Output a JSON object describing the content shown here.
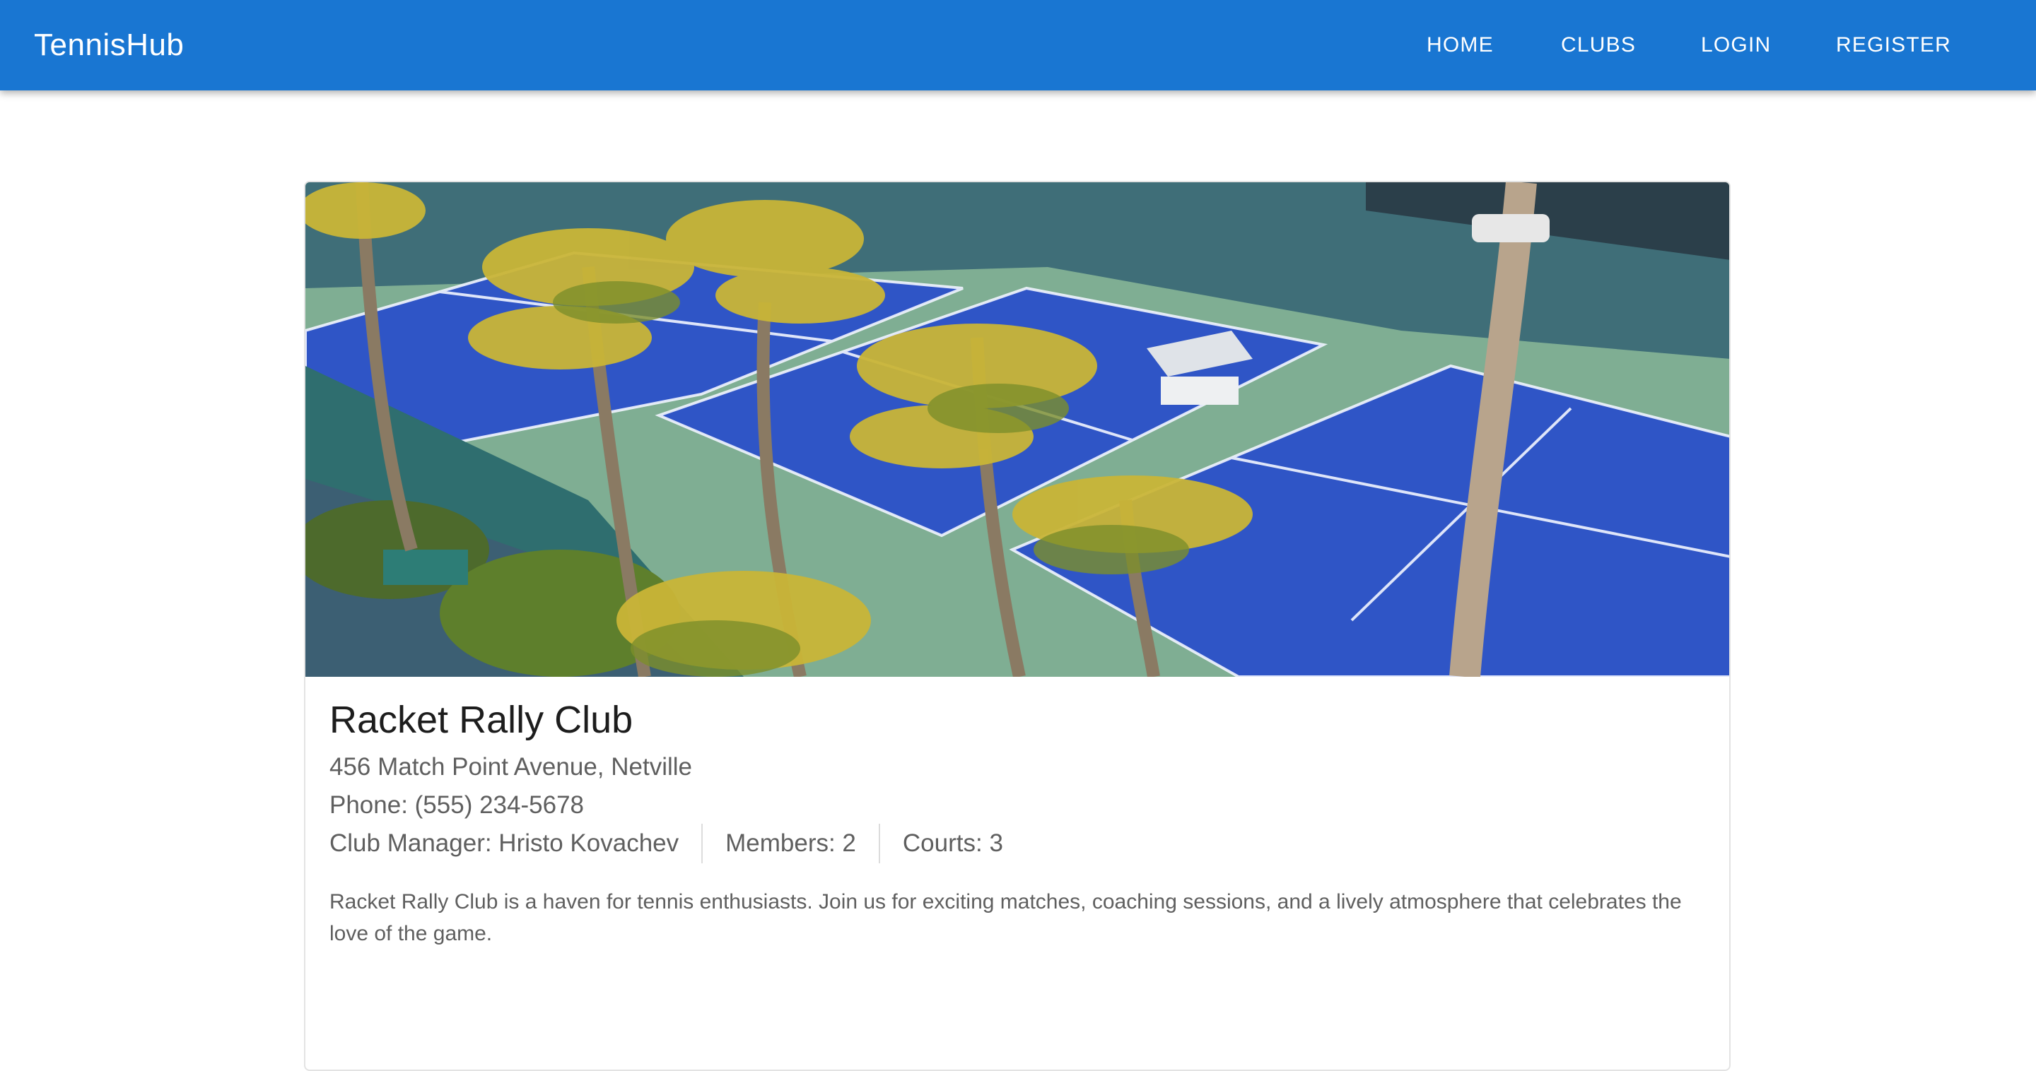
{
  "header": {
    "brand": "TennisHub",
    "nav": [
      {
        "label": "HOME"
      },
      {
        "label": "CLUBS"
      },
      {
        "label": "LOGIN"
      },
      {
        "label": "REGISTER"
      }
    ]
  },
  "club": {
    "name": "Racket Rally Club",
    "address": "456 Match Point Avenue, Netville",
    "phone": "Phone: (555) 234-5678",
    "manager": "Club Manager: Hristo Kovachev",
    "members": "Members: 2",
    "courts": "Courts: 3",
    "description": "Racket Rally Club is a haven for tennis enthusiasts. Join us for exciting matches, coaching sessions, and a lively atmosphere that celebrates the love of the game."
  },
  "colors": {
    "appbar": "#1976d2",
    "court_blue": "#2f55c6",
    "court_green": "#7fae93"
  },
  "icons": {
    "hero": "tennis-courts-photo"
  }
}
